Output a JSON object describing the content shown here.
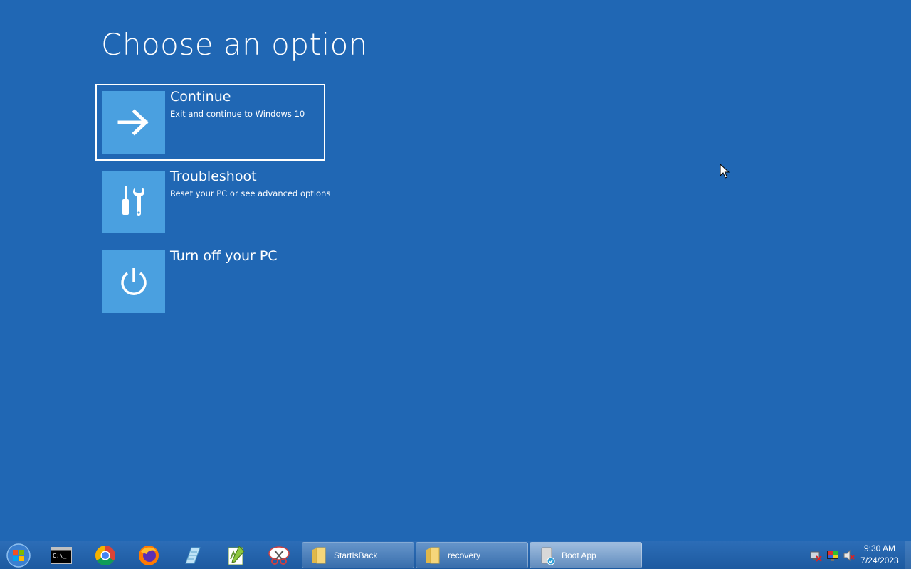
{
  "page": {
    "title": "Choose an option"
  },
  "options": [
    {
      "title": "Continue",
      "description": "Exit and continue to Windows 10",
      "icon": "arrow-right-icon",
      "selected": true
    },
    {
      "title": "Troubleshoot",
      "description": "Reset your PC or see advanced options",
      "icon": "tools-icon",
      "selected": false
    },
    {
      "title": "Turn off your PC",
      "description": "",
      "icon": "power-icon",
      "selected": false
    }
  ],
  "taskbar": {
    "start_icon": "windows-start-orb-icon",
    "pinned": [
      {
        "name": "command-prompt",
        "icon": "command-prompt-icon",
        "text": "C:\\_"
      },
      {
        "name": "chrome",
        "icon": "chrome-icon"
      },
      {
        "name": "firefox",
        "icon": "firefox-icon"
      },
      {
        "name": "notepad",
        "icon": "notepad-icon"
      },
      {
        "name": "notepad-plus-plus",
        "icon": "notepad-plus-plus-icon"
      },
      {
        "name": "snipping-tool",
        "icon": "snipping-tool-icon"
      }
    ],
    "tasks": [
      {
        "label": "StartIsBack",
        "icon": "folder-icon",
        "active": false
      },
      {
        "label": "recovery",
        "icon": "folder-icon",
        "active": false
      },
      {
        "label": "Boot App",
        "icon": "boot-app-icon",
        "active": true
      }
    ],
    "tray": {
      "icons": [
        "network-disconnected-icon",
        "color-display-icon",
        "volume-muted-icon"
      ],
      "time": "9:30 AM",
      "date": "7/24/2023"
    }
  },
  "colors": {
    "background": "#2067b4",
    "tile": "#4aa0e0",
    "text": "#ffffff"
  }
}
